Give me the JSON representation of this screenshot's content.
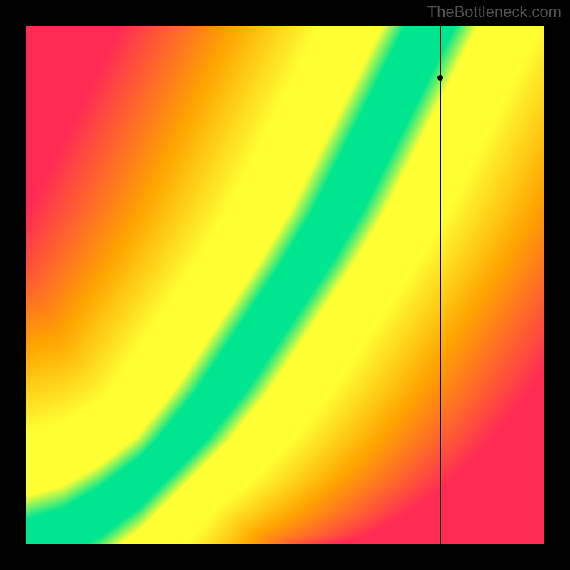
{
  "watermark": "TheBottleneck.com",
  "chart_data": {
    "type": "heatmap",
    "title": "",
    "xlabel": "",
    "ylabel": "",
    "xlim": [
      0,
      100
    ],
    "ylim": [
      0,
      100
    ],
    "crosshair": {
      "x": 80,
      "y": 90
    },
    "color_stops": [
      {
        "pct": 0.0,
        "color": "#ff2b55"
      },
      {
        "pct": 0.4,
        "color": "#ffa500"
      },
      {
        "pct": 0.7,
        "color": "#ffff33"
      },
      {
        "pct": 0.92,
        "color": "#ffff33"
      },
      {
        "pct": 1.0,
        "color": "#00e690"
      }
    ],
    "optimal_curve": [
      {
        "x": 0,
        "y": 0
      },
      {
        "x": 7,
        "y": 2
      },
      {
        "x": 14,
        "y": 6
      },
      {
        "x": 22,
        "y": 12
      },
      {
        "x": 30,
        "y": 20
      },
      {
        "x": 38,
        "y": 30
      },
      {
        "x": 46,
        "y": 42
      },
      {
        "x": 54,
        "y": 54
      },
      {
        "x": 60,
        "y": 64
      },
      {
        "x": 66,
        "y": 76
      },
      {
        "x": 72,
        "y": 88
      },
      {
        "x": 78,
        "y": 100
      }
    ],
    "green_band_width_pct": 8
  }
}
